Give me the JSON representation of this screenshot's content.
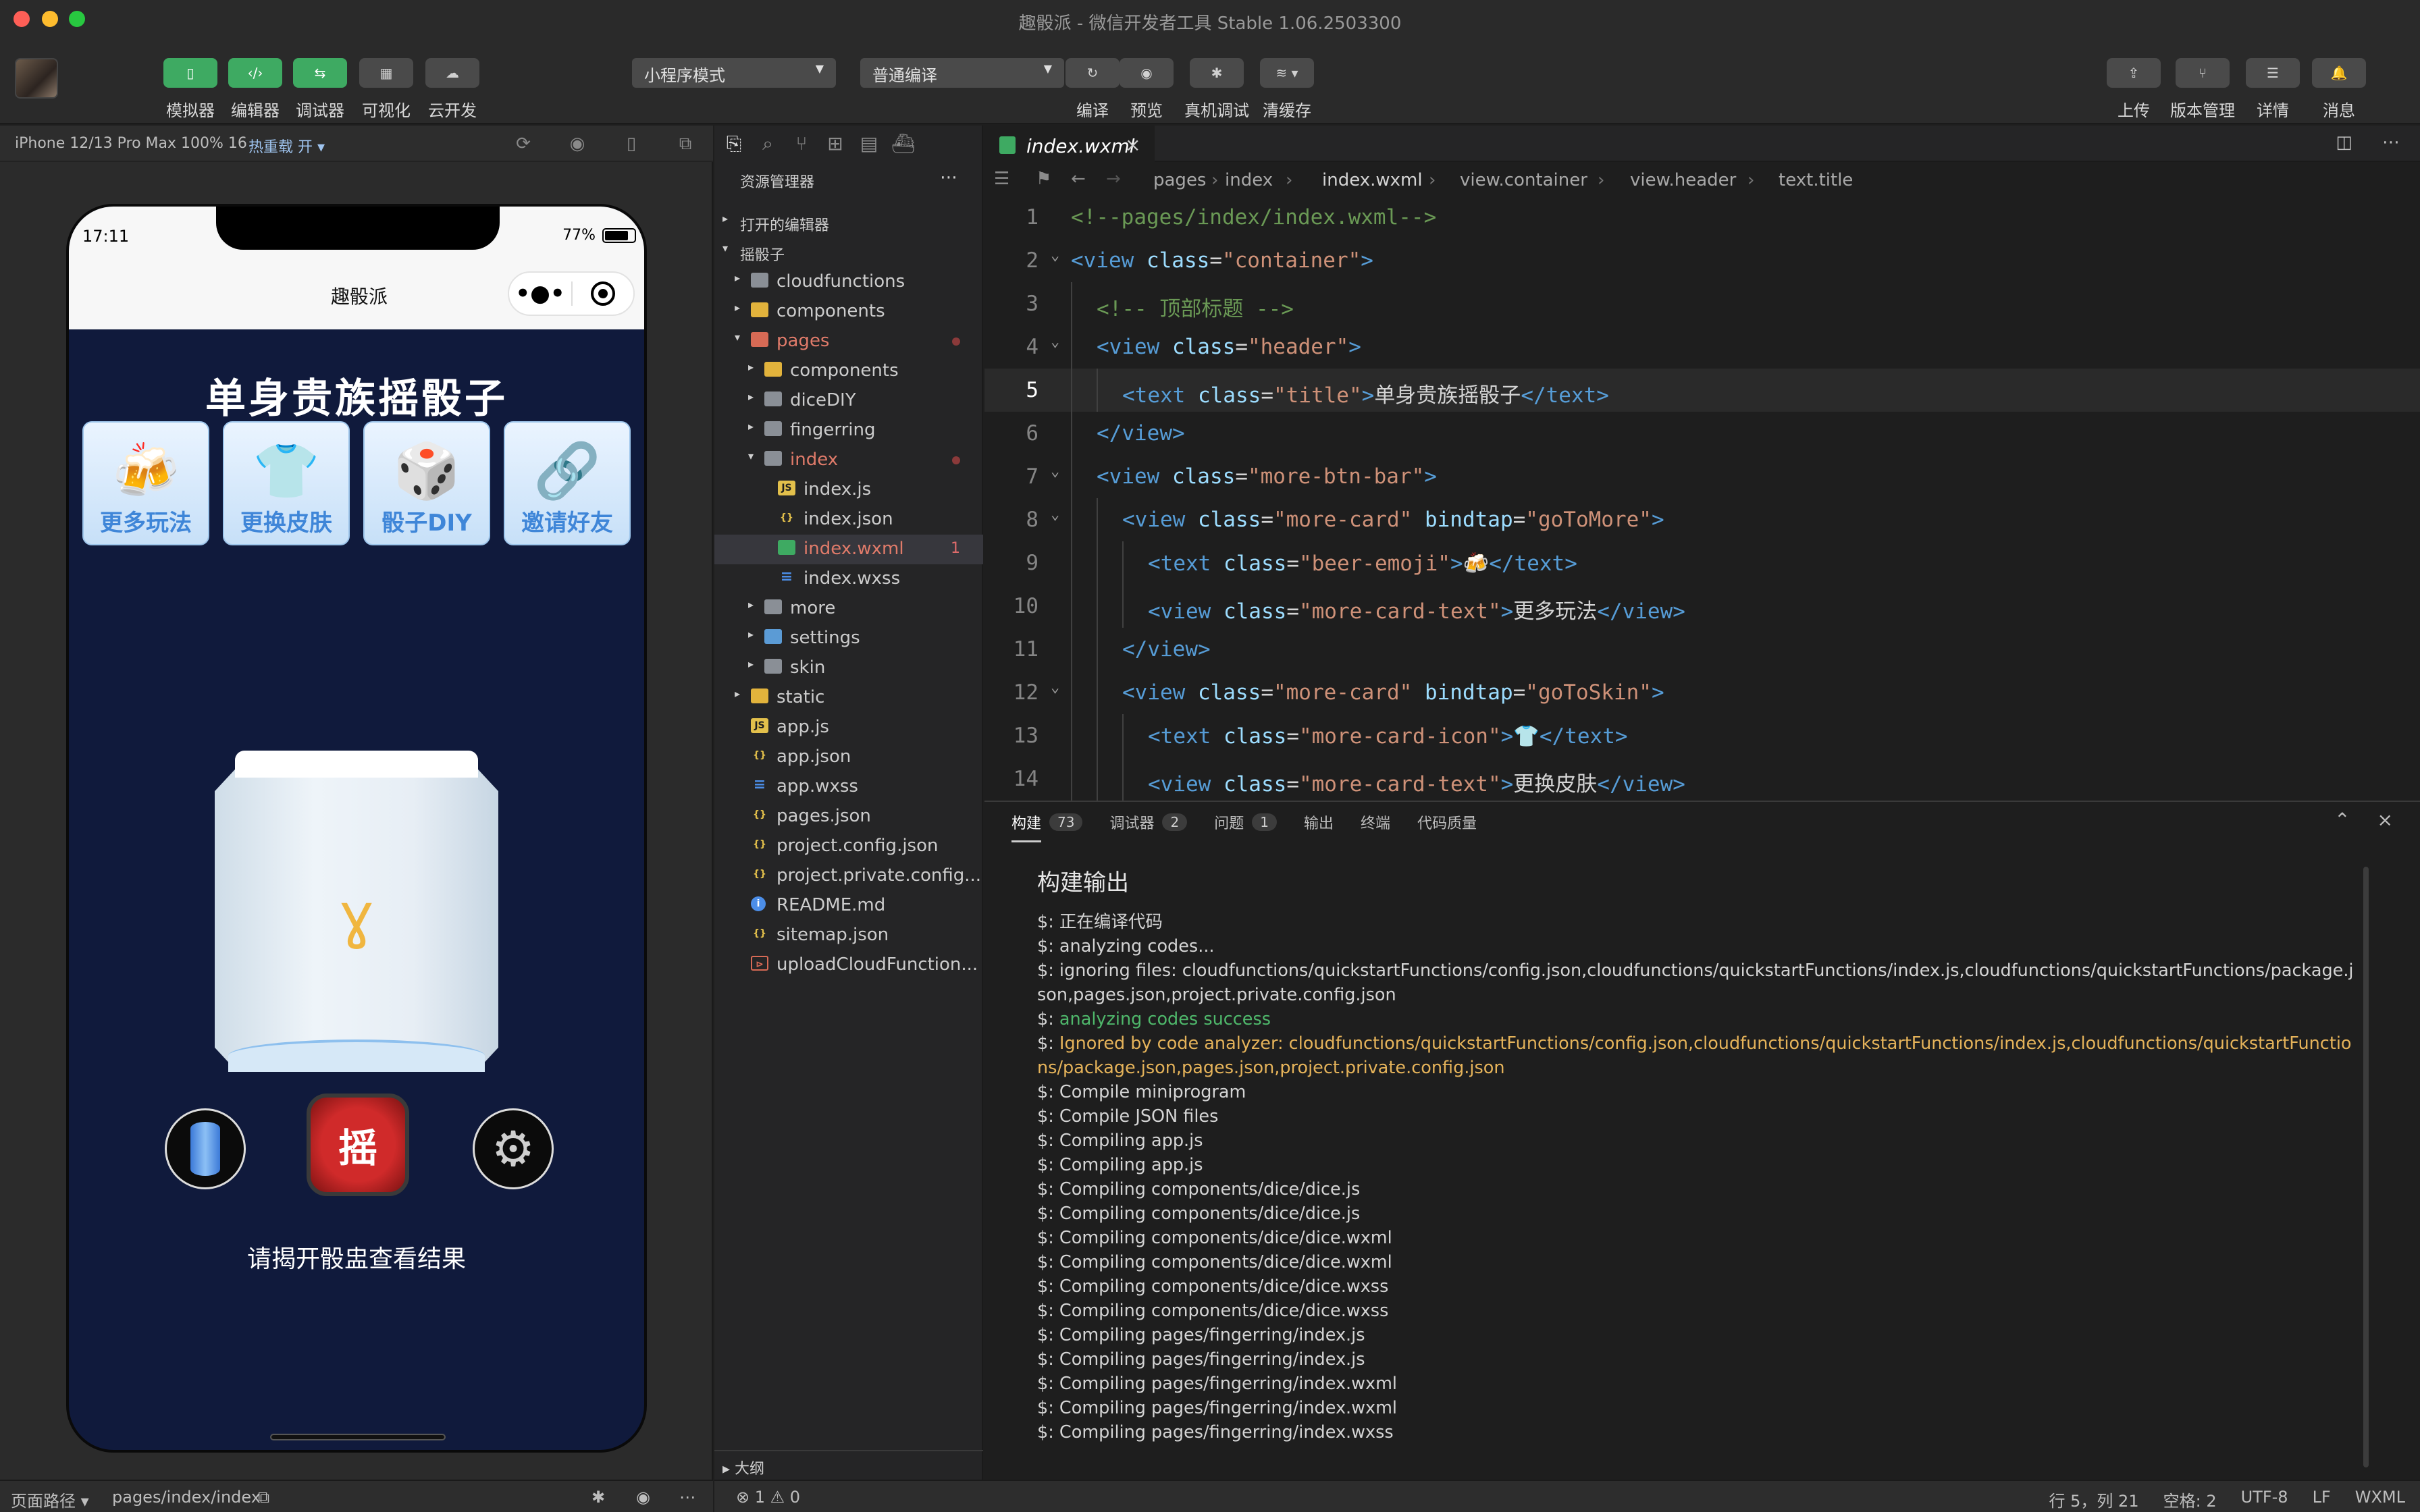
{
  "window": {
    "title": "趣骰派 - 微信开发者工具 Stable 1.06.2503300"
  },
  "toolbar": {
    "left_buttons": [
      "模拟器",
      "编辑器",
      "调试器",
      "可视化",
      "云开发"
    ],
    "mode_select": "小程序模式",
    "compile_select": "普通编译",
    "mid_buttons": [
      "编译",
      "预览",
      "真机调试",
      "清缓存"
    ],
    "right_buttons": [
      "上传",
      "版本管理",
      "详情",
      "消息"
    ]
  },
  "simulator": {
    "device": "iPhone 12/13 Pro Max 100% 16",
    "hot_reload": "热重载 开",
    "time": "17:11",
    "battery": "77%",
    "nav_title": "趣骰派",
    "app_title": "单身贵族摇骰子",
    "cards": [
      {
        "icon": "🍻",
        "label": "更多玩法"
      },
      {
        "icon": "👕",
        "label": "更换皮肤"
      },
      {
        "icon": "🎲",
        "label": "骰子DIY"
      },
      {
        "icon": "🔗",
        "label": "邀请好友"
      }
    ],
    "shake_label": "摇",
    "hint": "请揭开骰盅查看结果",
    "footer_label": "页面路径",
    "footer_path": "pages/index/index"
  },
  "explorer": {
    "header": "资源管理器",
    "open_editors": "打开的编辑器",
    "project": "摇骰子",
    "outline": "大纲",
    "tree": [
      {
        "name": "cloudfunctions",
        "type": "folder",
        "depth": 1,
        "arrow": "▸"
      },
      {
        "name": "components",
        "type": "folder-yellow",
        "depth": 1,
        "arrow": "▸"
      },
      {
        "name": "pages",
        "type": "folder-red",
        "depth": 1,
        "arrow": "▾",
        "color": "#e07b6a",
        "dot": true
      },
      {
        "name": "components",
        "type": "folder-yellow",
        "depth": 2,
        "arrow": "▸"
      },
      {
        "name": "diceDIY",
        "type": "folder",
        "depth": 2,
        "arrow": "▸"
      },
      {
        "name": "fingerring",
        "type": "folder",
        "depth": 2,
        "arrow": "▸"
      },
      {
        "name": "index",
        "type": "folder",
        "depth": 2,
        "arrow": "▾",
        "color": "#e07b6a",
        "dot": true
      },
      {
        "name": "index.js",
        "type": "js",
        "depth": 3
      },
      {
        "name": "index.json",
        "type": "json",
        "depth": 3
      },
      {
        "name": "index.wxml",
        "type": "wxml",
        "depth": 3,
        "color": "#e07b6a",
        "badge": "1",
        "selected": true
      },
      {
        "name": "index.wxss",
        "type": "wxss",
        "depth": 3
      },
      {
        "name": "more",
        "type": "folder",
        "depth": 2,
        "arrow": "▸"
      },
      {
        "name": "settings",
        "type": "folder-blue",
        "depth": 2,
        "arrow": "▸"
      },
      {
        "name": "skin",
        "type": "folder",
        "depth": 2,
        "arrow": "▸"
      },
      {
        "name": "static",
        "type": "folder-yellow",
        "depth": 1,
        "arrow": "▸"
      },
      {
        "name": "app.js",
        "type": "js",
        "depth": 1
      },
      {
        "name": "app.json",
        "type": "json",
        "depth": 1
      },
      {
        "name": "app.wxss",
        "type": "wxss",
        "depth": 1
      },
      {
        "name": "pages.json",
        "type": "json",
        "depth": 1
      },
      {
        "name": "project.config.json",
        "type": "json",
        "depth": 1
      },
      {
        "name": "project.private.config...",
        "type": "json",
        "depth": 1
      },
      {
        "name": "README.md",
        "type": "info",
        "depth": 1
      },
      {
        "name": "sitemap.json",
        "type": "json",
        "depth": 1
      },
      {
        "name": "uploadCloudFunction...",
        "type": "sh",
        "depth": 1
      }
    ]
  },
  "editor": {
    "tab": "index.wxml",
    "breadcrumbs": [
      "pages",
      "index",
      "index.wxml",
      "view.container",
      "view.header",
      "text.title"
    ],
    "lines": [
      {
        "n": "1",
        "indent": 0,
        "parts": [
          [
            "k-com",
            "<!--pages/index/index.wxml-->"
          ]
        ]
      },
      {
        "n": "2",
        "indent": 0,
        "fold": true,
        "parts": [
          [
            "k-tag",
            "<view "
          ],
          [
            "k-attr",
            "class"
          ],
          [
            "k-txt",
            "="
          ],
          [
            "k-str",
            "\"container\""
          ],
          [
            "k-tag",
            ">"
          ]
        ]
      },
      {
        "n": "3",
        "indent": 1,
        "parts": [
          [
            "k-com",
            "<!-- 顶部标题 -->"
          ]
        ]
      },
      {
        "n": "4",
        "indent": 1,
        "fold": true,
        "parts": [
          [
            "k-tag",
            "<view "
          ],
          [
            "k-attr",
            "class"
          ],
          [
            "k-txt",
            "="
          ],
          [
            "k-str",
            "\"header\""
          ],
          [
            "k-tag",
            ">"
          ]
        ]
      },
      {
        "n": "5",
        "indent": 2,
        "current": true,
        "parts": [
          [
            "k-tag",
            "<text "
          ],
          [
            "k-attr",
            "class"
          ],
          [
            "k-txt",
            "="
          ],
          [
            "k-str",
            "\"title\""
          ],
          [
            "k-tag",
            ">"
          ],
          [
            "k-txt",
            "单身贵族摇骰子"
          ],
          [
            "k-tag",
            "</text>"
          ]
        ]
      },
      {
        "n": "6",
        "indent": 1,
        "parts": [
          [
            "k-tag",
            "</view>"
          ]
        ]
      },
      {
        "n": "7",
        "indent": 1,
        "fold": true,
        "parts": [
          [
            "k-tag",
            "<view "
          ],
          [
            "k-attr",
            "class"
          ],
          [
            "k-txt",
            "="
          ],
          [
            "k-str",
            "\"more-btn-bar\""
          ],
          [
            "k-tag",
            ">"
          ]
        ]
      },
      {
        "n": "8",
        "indent": 2,
        "fold": true,
        "parts": [
          [
            "k-tag",
            "<view "
          ],
          [
            "k-attr",
            "class"
          ],
          [
            "k-txt",
            "="
          ],
          [
            "k-str",
            "\"more-card\""
          ],
          [
            "k-txt",
            " "
          ],
          [
            "k-attr",
            "bindtap"
          ],
          [
            "k-txt",
            "="
          ],
          [
            "k-str",
            "\"goToMore\""
          ],
          [
            "k-tag",
            ">"
          ]
        ]
      },
      {
        "n": "9",
        "indent": 3,
        "parts": [
          [
            "k-tag",
            "<text "
          ],
          [
            "k-attr",
            "class"
          ],
          [
            "k-txt",
            "="
          ],
          [
            "k-str",
            "\"beer-emoji\""
          ],
          [
            "k-tag",
            ">"
          ],
          [
            "k-txt",
            "🍻"
          ],
          [
            "k-tag",
            "</text>"
          ]
        ]
      },
      {
        "n": "10",
        "indent": 3,
        "parts": [
          [
            "k-tag",
            "<view "
          ],
          [
            "k-attr",
            "class"
          ],
          [
            "k-txt",
            "="
          ],
          [
            "k-str",
            "\"more-card-text\""
          ],
          [
            "k-tag",
            ">"
          ],
          [
            "k-txt",
            "更多玩法"
          ],
          [
            "k-tag",
            "</view>"
          ]
        ]
      },
      {
        "n": "11",
        "indent": 2,
        "parts": [
          [
            "k-tag",
            "</view>"
          ]
        ]
      },
      {
        "n": "12",
        "indent": 2,
        "fold": true,
        "parts": [
          [
            "k-tag",
            "<view "
          ],
          [
            "k-attr",
            "class"
          ],
          [
            "k-txt",
            "="
          ],
          [
            "k-str",
            "\"more-card\""
          ],
          [
            "k-txt",
            " "
          ],
          [
            "k-attr",
            "bindtap"
          ],
          [
            "k-txt",
            "="
          ],
          [
            "k-str",
            "\"goToSkin\""
          ],
          [
            "k-tag",
            ">"
          ]
        ]
      },
      {
        "n": "13",
        "indent": 3,
        "parts": [
          [
            "k-tag",
            "<text "
          ],
          [
            "k-attr",
            "class"
          ],
          [
            "k-txt",
            "="
          ],
          [
            "k-str",
            "\"more-card-icon\""
          ],
          [
            "k-tag",
            ">"
          ],
          [
            "k-txt",
            "👕"
          ],
          [
            "k-tag",
            "</text>"
          ]
        ]
      },
      {
        "n": "14",
        "indent": 3,
        "parts": [
          [
            "k-tag",
            "<view "
          ],
          [
            "k-attr",
            "class"
          ],
          [
            "k-txt",
            "="
          ],
          [
            "k-str",
            "\"more-card-text\""
          ],
          [
            "k-tag",
            ">"
          ],
          [
            "k-txt",
            "更换皮肤"
          ],
          [
            "k-tag",
            "</view>"
          ]
        ]
      }
    ]
  },
  "panel": {
    "tabs": [
      {
        "label": "构建",
        "count": "73",
        "active": true
      },
      {
        "label": "调试器",
        "count": "2"
      },
      {
        "label": "问题",
        "count": "1"
      },
      {
        "label": "输出"
      },
      {
        "label": "终端"
      },
      {
        "label": "代码质量"
      }
    ],
    "title": "构建输出",
    "log": [
      {
        "t": "$: 正在编译代码"
      },
      {
        "t": "$: analyzing codes..."
      },
      {
        "t": "$: ignoring files: cloudfunctions/quickstartFunctions/config.json,cloudfunctions/quickstartFunctions/index.js,cloudfunctions/quickstartFunctions/package.json,pages.json,project.private.config.json"
      },
      {
        "t": "$: ",
        "hl": "analyzing codes success",
        "cls": "log-green"
      },
      {
        "t": "$: ",
        "hl": "Ignored by code analyzer: cloudfunctions/quickstartFunctions/config.json,cloudfunctions/quickstartFunctions/index.js,cloudfunctions/quickstartFunctions/package.json,pages.json,project.private.config.json",
        "cls": "log-orange"
      },
      {
        "t": "$: Compile miniprogram"
      },
      {
        "t": "$: Compile JSON files"
      },
      {
        "t": "$: Compiling app.js"
      },
      {
        "t": "$: Compiling app.js"
      },
      {
        "t": "$: Compiling components/dice/dice.js"
      },
      {
        "t": "$: Compiling components/dice/dice.js"
      },
      {
        "t": "$: Compiling components/dice/dice.wxml"
      },
      {
        "t": "$: Compiling components/dice/dice.wxml"
      },
      {
        "t": "$: Compiling components/dice/dice.wxss"
      },
      {
        "t": "$: Compiling components/dice/dice.wxss"
      },
      {
        "t": "$: Compiling pages/fingerring/index.js"
      },
      {
        "t": "$: Compiling pages/fingerring/index.js"
      },
      {
        "t": "$: Compiling pages/fingerring/index.wxml"
      },
      {
        "t": "$: Compiling pages/fingerring/index.wxml"
      },
      {
        "t": "$: Compiling pages/fingerring/index.wxss"
      }
    ]
  },
  "status": {
    "problems": "⊗ 1 ⚠ 0",
    "position": "行 5，列 21",
    "spaces": "空格: 2",
    "encoding": "UTF-8",
    "eol": "LF",
    "language": "WXML"
  }
}
